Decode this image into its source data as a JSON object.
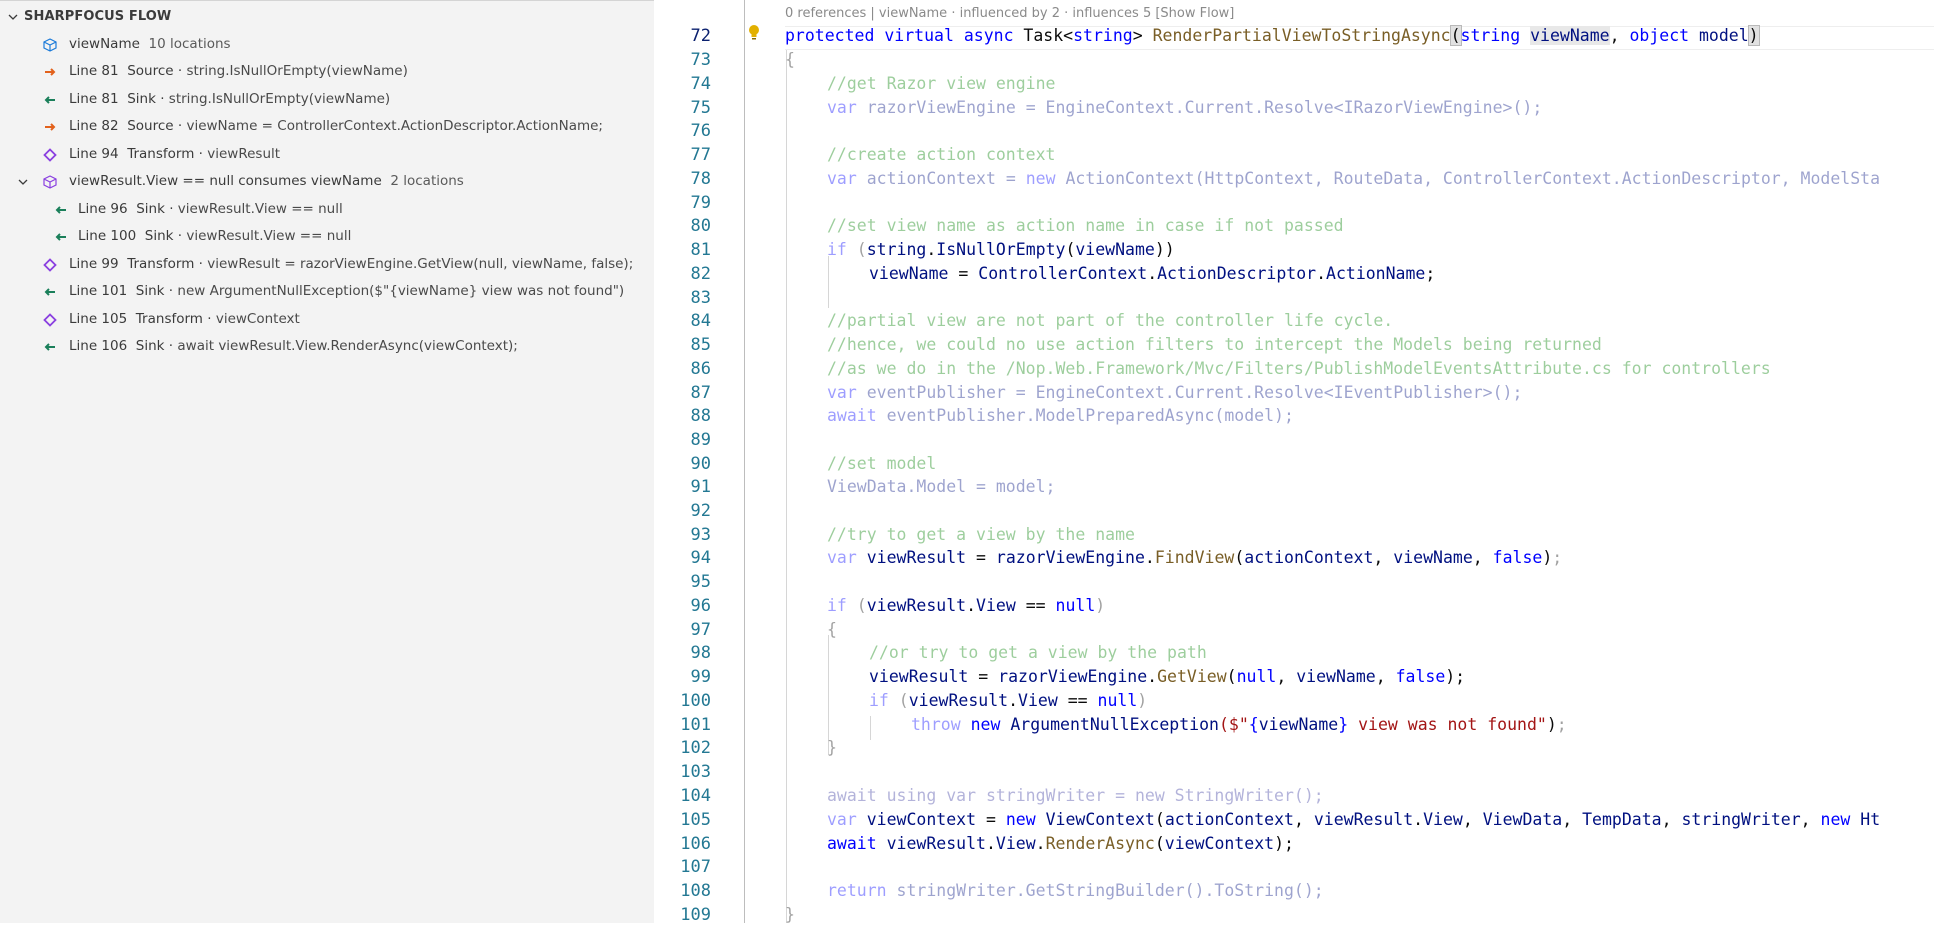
{
  "panel": {
    "title": "SHARPFOCUS FLOW",
    "root": {
      "label": "viewName",
      "count": "10 locations"
    },
    "items": [
      {
        "line": "Line 81",
        "kind": "Source",
        "detail": "string.IsNullOrEmpty(viewName)"
      },
      {
        "line": "Line 81",
        "kind": "Sink",
        "detail": "string.IsNullOrEmpty(viewName)"
      },
      {
        "line": "Line 82",
        "kind": "Source",
        "detail": "viewName = ControllerContext.ActionDescriptor.ActionName;"
      },
      {
        "line": "Line 94",
        "kind": "Transform",
        "detail": "viewResult"
      }
    ],
    "group": {
      "label": "viewResult.View == null consumes viewName",
      "count": "2 locations",
      "items": [
        {
          "line": "Line 96",
          "kind": "Sink",
          "detail": "viewResult.View == null"
        },
        {
          "line": "Line 100",
          "kind": "Sink",
          "detail": "viewResult.View == null"
        }
      ]
    },
    "items2": [
      {
        "line": "Line 99",
        "kind": "Transform",
        "detail": "viewResult = razorViewEngine.GetView(null, viewName, false);"
      },
      {
        "line": "Line 101",
        "kind": "Sink",
        "detail": "new ArgumentNullException($\"{viewName} view was not found\")"
      },
      {
        "line": "Line 105",
        "kind": "Transform",
        "detail": "viewContext"
      },
      {
        "line": "Line 106",
        "kind": "Sink",
        "detail": "await viewResult.View.RenderAsync(viewContext);"
      }
    ],
    "sep": "·"
  },
  "editor": {
    "codelens": "0 references | viewName · influenced by 2 · influences 5 [Show Flow]",
    "line_numbers": [
      "72",
      "73",
      "74",
      "75",
      "76",
      "77",
      "78",
      "79",
      "80",
      "81",
      "82",
      "83",
      "84",
      "85",
      "86",
      "87",
      "88",
      "89",
      "90",
      "91",
      "92",
      "93",
      "94",
      "95",
      "96",
      "97",
      "98",
      "99",
      "100",
      "101",
      "102",
      "103",
      "104",
      "105",
      "106",
      "107",
      "108",
      "109"
    ],
    "code": {
      "l72": [
        "protected",
        " ",
        "virtual",
        " ",
        "async",
        " Task<",
        "string",
        "> ",
        "RenderPartialViewToStringAsync",
        "(",
        "string",
        " ",
        "viewName",
        ", ",
        "object",
        " model",
        ")"
      ],
      "l73": "{",
      "l74": "//get Razor view engine",
      "l75": [
        "var",
        " razorViewEngine = EngineContext.Current.Resolve<IRazorViewEngine>();"
      ],
      "l77": "//create action context",
      "l78": [
        "var",
        " actionContext = ",
        "new",
        " ActionContext(HttpContext, RouteData, ControllerContext.ActionDescriptor, ModelSta"
      ],
      "l80": "//set view name as action name in case if not passed",
      "l81": [
        "if",
        " (",
        "string",
        ".",
        "IsNullOrEmpty",
        "(",
        "viewName",
        "))"
      ],
      "l82": [
        "viewName",
        " = ",
        "ControllerContext",
        ".",
        "ActionDescriptor",
        ".",
        "ActionName",
        ";"
      ],
      "l84": "//partial view are not part of the controller life cycle.",
      "l85": "//hence, we could no use action filters to intercept the Models being returned",
      "l86": "//as we do in the /Nop.Web.Framework/Mvc/Filters/PublishModelEventsAttribute.cs for controllers",
      "l87": [
        "var",
        " eventPublisher = EngineContext.Current.Resolve<IEventPublisher>();"
      ],
      "l88": [
        "await",
        " eventPublisher.ModelPreparedAsync(model);"
      ],
      "l90": "//set model",
      "l91": "ViewData.Model = model;",
      "l93": "//try to get a view by the name",
      "l94": [
        "var",
        " ",
        "viewResult",
        " = ",
        "razorViewEngine",
        ".",
        "FindView",
        "(",
        "actionContext",
        ", ",
        "viewName",
        ", ",
        "false",
        ")",
        ";"
      ],
      "l96": [
        "if",
        " (",
        "viewResult",
        ".",
        "View",
        " == ",
        "null",
        ")"
      ],
      "l97": "{",
      "l98": "//or try to get a view by the path",
      "l99": [
        "viewResult",
        " = ",
        "razorViewEngine",
        ".",
        "GetView",
        "(",
        "null",
        ", ",
        "viewName",
        ", ",
        "false",
        ");"
      ],
      "l100": [
        "if",
        " (",
        "viewResult",
        ".",
        "View",
        " == ",
        "null",
        ")"
      ],
      "l101": [
        "throw",
        " ",
        "new",
        " ",
        "ArgumentNullException",
        "($\"",
        "{",
        "viewName",
        "}",
        " view was not found\"",
        ")",
        ";"
      ],
      "l102": "}",
      "l104": "await using var stringWriter = new StringWriter();",
      "l105": [
        "var",
        " ",
        "viewContext",
        " = ",
        "new",
        " ",
        "ViewContext",
        "(",
        "actionContext",
        ", ",
        "viewResult",
        ".",
        "View",
        ", ",
        "ViewData",
        ", ",
        "TempData",
        ", ",
        "stringWriter",
        ", ",
        "new",
        " Ht"
      ],
      "l106": [
        "await",
        " ",
        "viewResult",
        ".",
        "View",
        ".",
        "RenderAsync",
        "(",
        "viewContext",
        ");"
      ],
      "l108": [
        "return",
        " stringWriter.GetStringBuilder().ToString();"
      ],
      "l109": "}"
    }
  },
  "colors": {
    "panel_bg": "#f3f3f3",
    "source_icon": "#e2611b",
    "sink_icon": "#1a7f5a",
    "transform_icon": "#8a3fe0",
    "symbol_icon": "#1c7bd9",
    "keyword": "#0000ff",
    "identifier": "#001080",
    "method": "#795e26",
    "string": "#a31515",
    "comment": "#008000"
  }
}
